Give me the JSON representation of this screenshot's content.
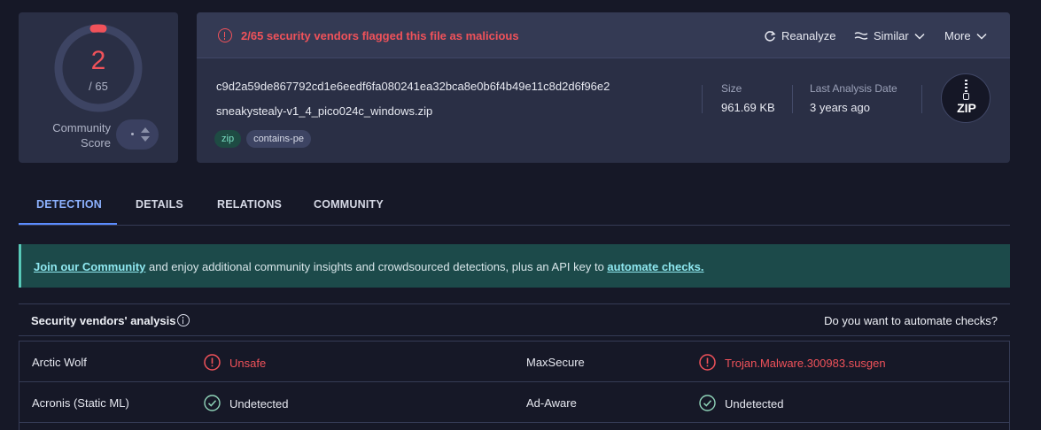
{
  "score": {
    "detections": "2",
    "total": "/ 65",
    "community_label_1": "Community",
    "community_label_2": "Score"
  },
  "file": {
    "alert": "2/65 security vendors flagged this file as malicious",
    "actions": {
      "reanalyze": "Reanalyze",
      "similar": "Similar",
      "more": "More"
    },
    "hash": "c9d2a59de867792cd1e6eedf6fa080241ea32bca8e0b6f4b49e11c8d2d6f96e2",
    "name": "sneakystealy-v1_4_pico024c_windows.zip",
    "tags": [
      "zip",
      "contains-pe"
    ],
    "size_label": "Size",
    "size_value": "961.69 KB",
    "date_label": "Last Analysis Date",
    "date_value": "3 years ago",
    "type_badge": "ZIP"
  },
  "tabs": [
    "DETECTION",
    "DETAILS",
    "RELATIONS",
    "COMMUNITY"
  ],
  "banner": {
    "link1": "Join our Community",
    "middle": " and enjoy additional community insights and crowdsourced detections, plus an API key to ",
    "link2": "automate checks."
  },
  "analysis": {
    "title": "Security vendors' analysis",
    "automate_question": "Do you want to automate checks?",
    "rows": [
      {
        "v1": "Arctic Wolf",
        "r1": "Unsafe",
        "v2": "MaxSecure",
        "r2": "Trojan.Malware.300983.susgen"
      },
      {
        "v1": "Acronis (Static ML)",
        "r1": "Undetected",
        "v2": "Ad-Aware",
        "r2": "Undetected"
      }
    ]
  },
  "colors": {
    "malicious": "#f0525a",
    "accent": "#5b8cff",
    "banner": "#1c4a4a"
  }
}
